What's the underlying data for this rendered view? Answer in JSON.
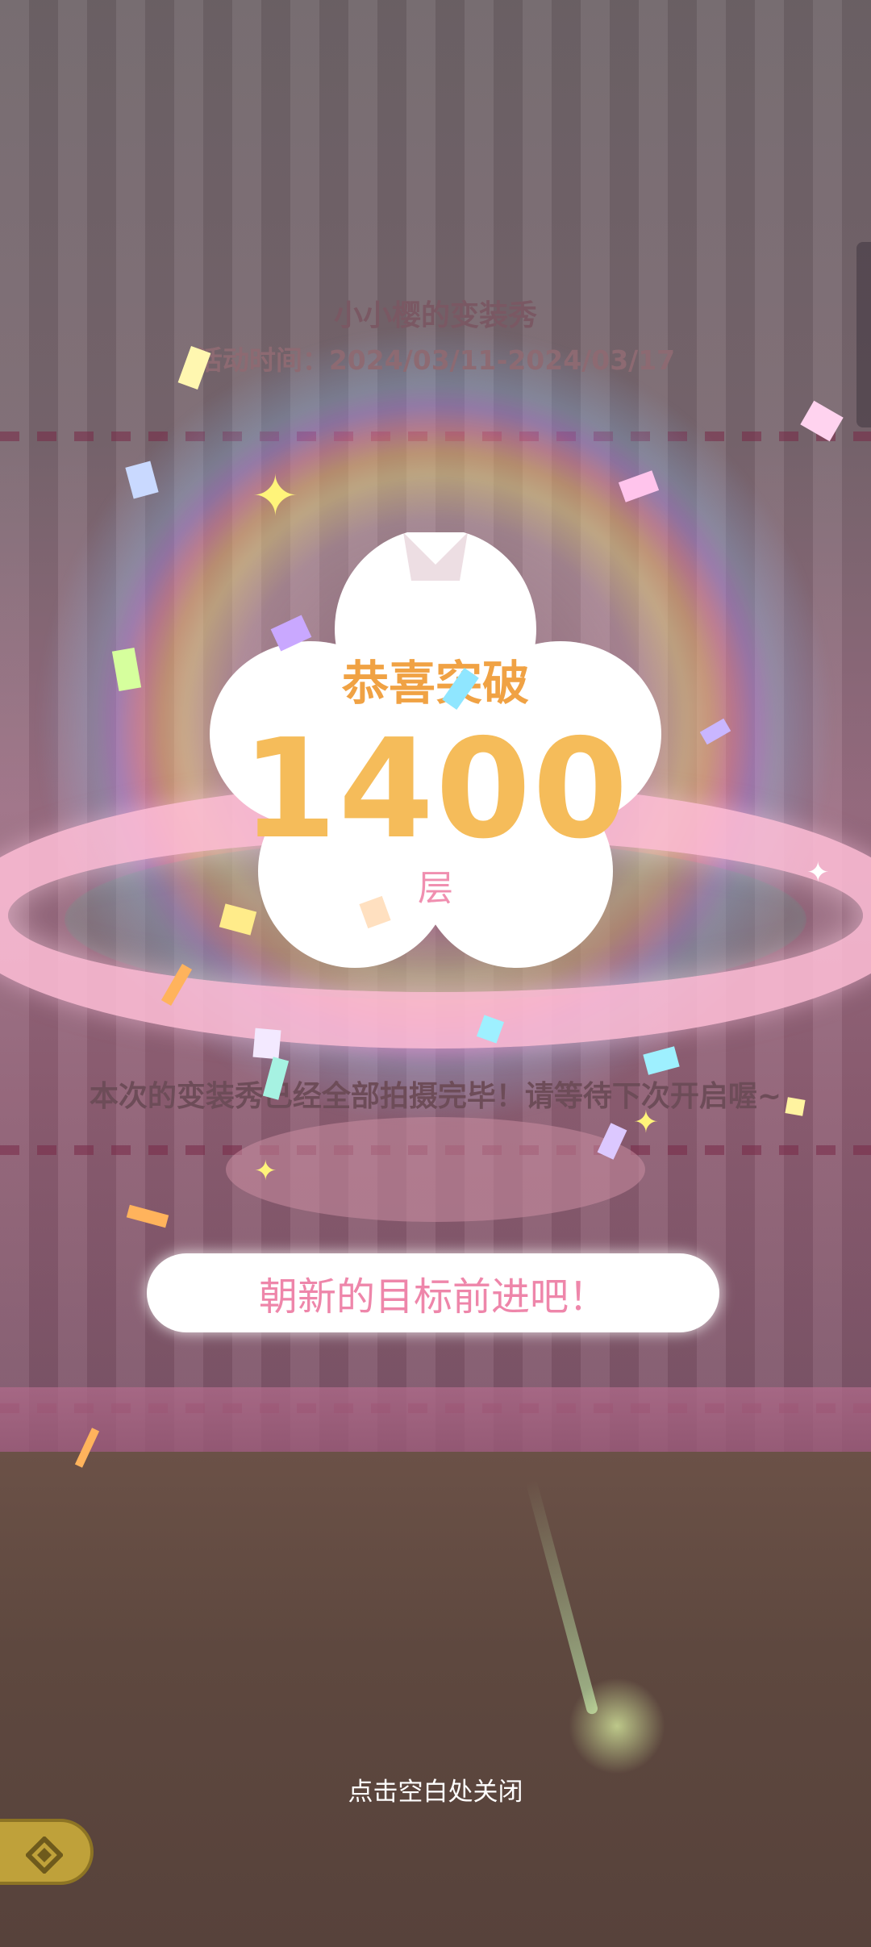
{
  "event": {
    "title": "小小樱的变装秀",
    "period": "活动时间：2024/03/11-2024/03/17",
    "ended_notice": "本次的变装秀已经全部拍摄完毕！请等待下次开启喔~"
  },
  "badge": {
    "congrats": "恭喜突破",
    "count": "1400",
    "unit": "层"
  },
  "actions": {
    "cta_label": "朝新的目标前进吧！",
    "close_hint": "点击空白处关闭"
  },
  "icons": {
    "back": "diamond-back-icon",
    "flower": "sakura-flower"
  },
  "colors": {
    "accent_orange": "#f5bc5a",
    "accent_pink": "#ee86aa",
    "ring_pink": "#ffbed7"
  }
}
